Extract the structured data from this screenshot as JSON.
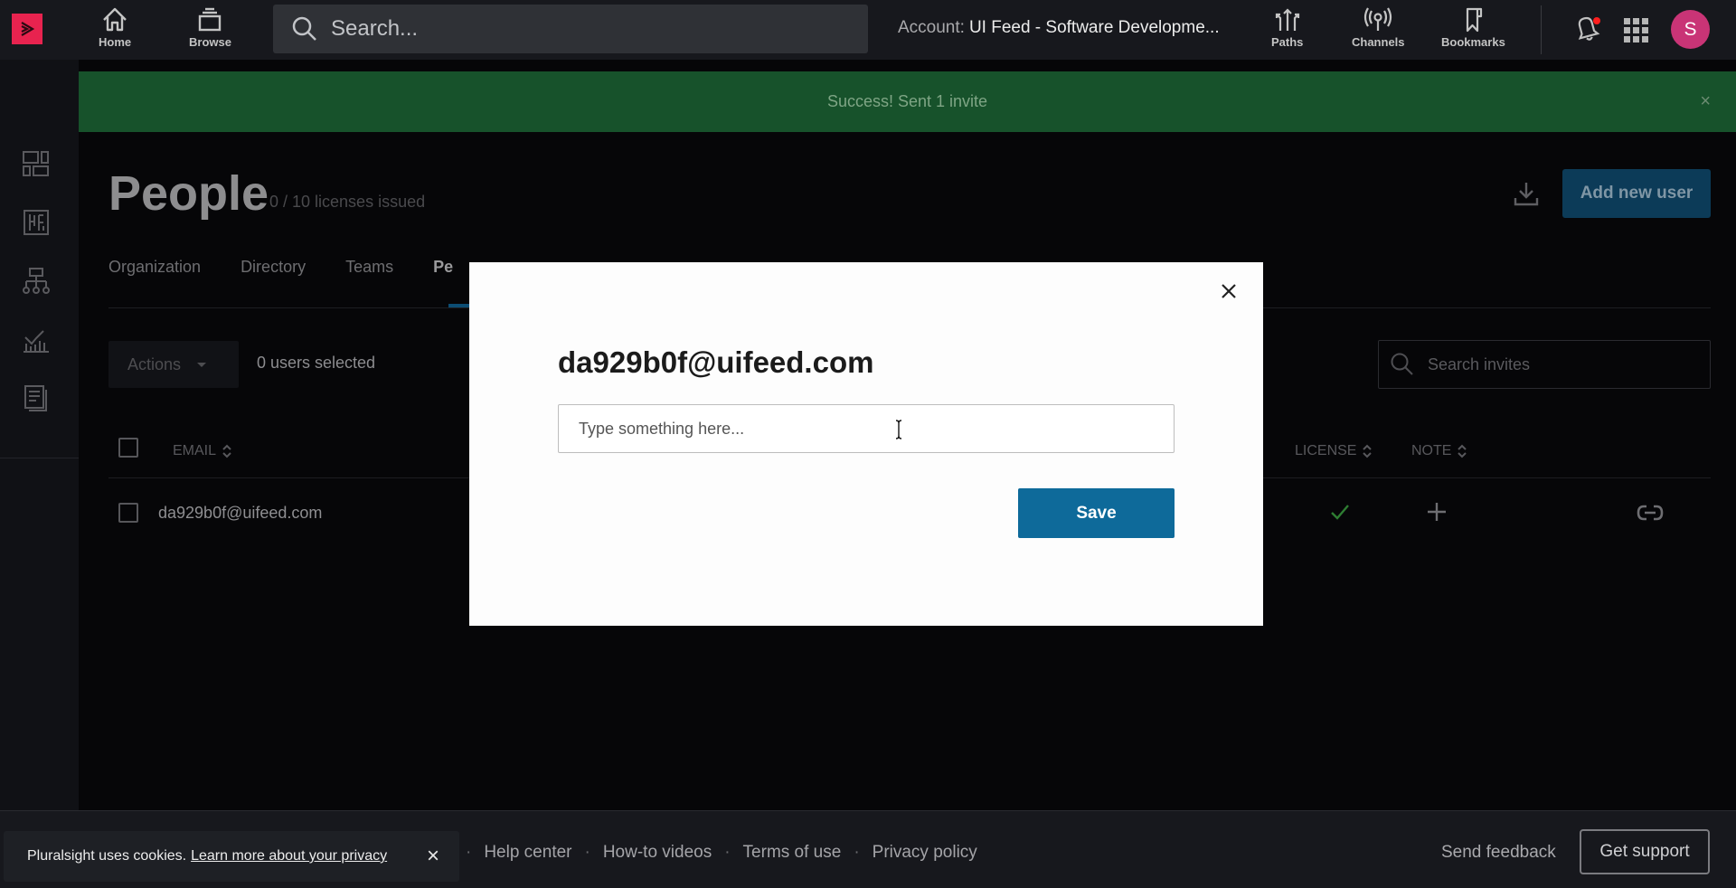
{
  "topnav": {
    "logo_icon": "pluralsight-play-icon",
    "home_label": "Home",
    "browse_label": "Browse",
    "search_placeholder": "Search...",
    "account_label": "Account:",
    "account_name": "UI Feed - Software Developme...",
    "paths_label": "Paths",
    "channels_label": "Channels",
    "bookmarks_label": "Bookmarks",
    "avatar_initial": "S",
    "notification_indicator": true
  },
  "siderail": {
    "icons": [
      "dashboard-icon",
      "skills-icon",
      "org-chart-icon",
      "analytics-icon",
      "reports-icon"
    ]
  },
  "banner": {
    "message": "Success! Sent 1 invite",
    "close_label": "×"
  },
  "page": {
    "title": "People",
    "licenses": "0 / 10 licenses issued",
    "add_user_label": "Add new user",
    "tabs": [
      {
        "label": "Organization",
        "active": false
      },
      {
        "label": "Directory",
        "active": false
      },
      {
        "label": "Teams",
        "active": false
      },
      {
        "label": "Pe",
        "active": true
      }
    ],
    "actions_label": "Actions",
    "selected_count": "0 users selected",
    "search_invites_placeholder": "Search invites",
    "table": {
      "columns": [
        "EMAIL",
        "LICENSE",
        "NOTE"
      ],
      "rows": [
        {
          "email": "da929b0f@uifeed.com",
          "license": "check",
          "note": "add"
        }
      ]
    }
  },
  "modal": {
    "title": "da929b0f@uifeed.com",
    "input_value": "",
    "input_placeholder": "Type something here...",
    "save_label": "Save",
    "close_label": "×"
  },
  "footer": {
    "cookie_text": "Pluralsight uses cookies.",
    "cookie_link": "Learn more about your privacy",
    "cookie_close": "×",
    "links": [
      "Help center",
      "How-to videos",
      "Terms of use",
      "Privacy policy"
    ],
    "separator": "·",
    "send_feedback": "Send feedback",
    "get_support": "Get support"
  },
  "colors": {
    "brand": "#e8234f",
    "avatar": "#c93476",
    "banner_success": "#17522b",
    "primary_button": "#0e6a9a",
    "license_check": "#2e7d32"
  }
}
